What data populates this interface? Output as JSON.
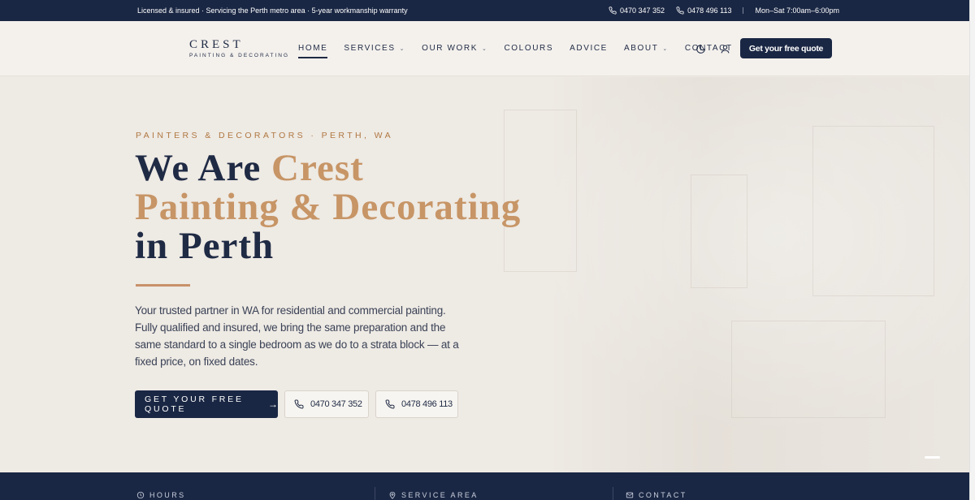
{
  "topbar": {
    "tagline": "Licensed & insured · Servicing the Perth metro area · 5-year workmanship warranty",
    "phone1": "0470 347 352",
    "phone2": "0478 496 113",
    "hours": "Mon–Sat 7:00am–6:00pm"
  },
  "header": {
    "brand": "CREST",
    "brand_tagline": "PAINTING & DECORATING",
    "nav": [
      {
        "label": "HOME",
        "active": true,
        "dropdown": false
      },
      {
        "label": "SERVICES",
        "active": false,
        "dropdown": true
      },
      {
        "label": "OUR WORK",
        "active": false,
        "dropdown": true
      },
      {
        "label": "COLOURS",
        "active": false,
        "dropdown": false
      },
      {
        "label": "ADVICE",
        "active": false,
        "dropdown": false
      },
      {
        "label": "ABOUT",
        "active": false,
        "dropdown": true
      },
      {
        "label": "CONTACT",
        "active": false,
        "dropdown": false
      }
    ],
    "quote_button": "Get your free quote"
  },
  "hero": {
    "eyebrow": "PAINTERS & DECORATORS · PERTH, WA",
    "title_line1_a": "We Are ",
    "title_line1_b": "Crest",
    "title_line2": "Painting & Decorating",
    "title_line3": "in Perth",
    "lead": "Your trusted partner in WA for residential and commercial painting. Fully qualified and insured, we bring the same preparation and the same standard to a single bedroom as we do to a strata block — at a fixed price, on fixed dates.",
    "cta_label": "GET YOUR FREE QUOTE",
    "cta_arrow": "→",
    "phone1": "0470 347 352",
    "phone2": "0478 496 113"
  },
  "strip": {
    "hours": "HOURS",
    "service_area": "SERVICE AREA",
    "contact": "CONTACT"
  },
  "colors": {
    "navy": "#1a2744",
    "gold": "#c79566",
    "background": "#eeeae4"
  }
}
